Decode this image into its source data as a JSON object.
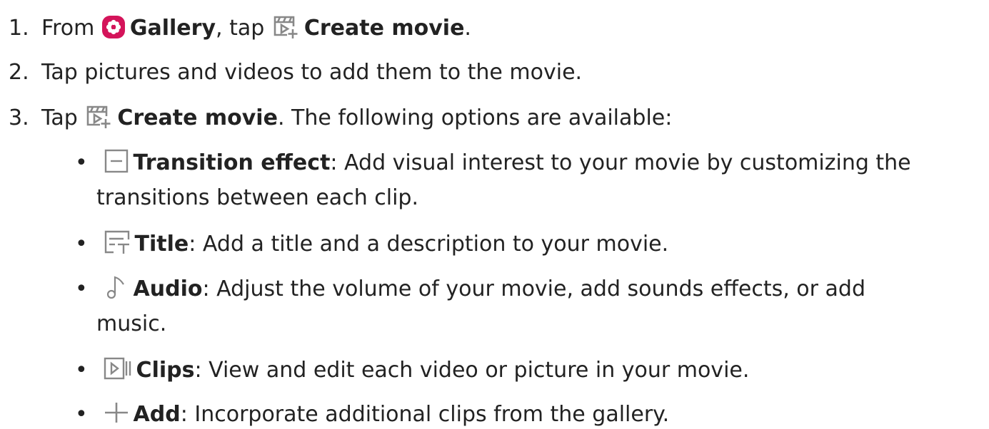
{
  "steps": [
    {
      "number": "1.",
      "pre": "From",
      "app_icon": "gallery-app-icon",
      "app_name": "Gallery",
      "mid": ", tap",
      "action_icon": "create-movie-icon",
      "action_label": "Create movie",
      "post": "."
    },
    {
      "number": "2.",
      "text": "Tap pictures and videos to add them to the movie."
    },
    {
      "number": "3.",
      "pre": "Tap",
      "action_icon": "create-movie-icon",
      "action_label": "Create movie",
      "post": ". The following options are available:"
    }
  ],
  "options": [
    {
      "icon": "transition-effect-icon",
      "label": "Transition effect",
      "desc": ": Add visual interest to your movie by customizing the",
      "desc_cont": "transitions between each clip."
    },
    {
      "icon": "title-icon",
      "label": "Title",
      "desc": ": Add a title and a description to your movie."
    },
    {
      "icon": "audio-icon",
      "label": "Audio",
      "desc": ": Adjust the volume of your movie, add sounds effects, or add",
      "desc_cont": "music."
    },
    {
      "icon": "clips-icon",
      "label": "Clips",
      "desc": ": View and edit each video or picture in your movie."
    },
    {
      "icon": "add-icon",
      "label": "Add",
      "desc": ": Incorporate additional clips from the gallery."
    }
  ],
  "bullet": "•",
  "colors": {
    "text": "#222222",
    "gallery_icon_bg": "#d4145a",
    "icon_stroke": "#888888"
  }
}
